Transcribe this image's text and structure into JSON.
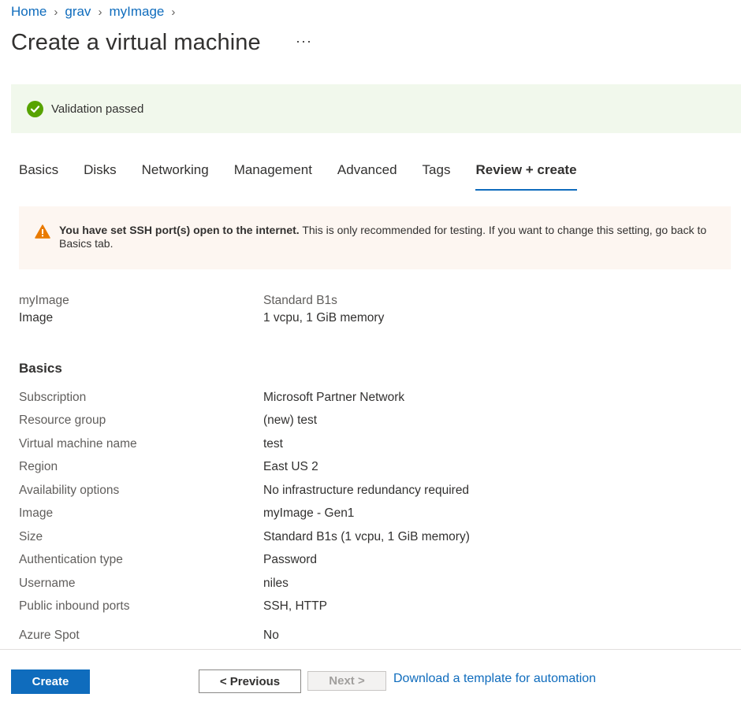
{
  "breadcrumb": [
    {
      "label": "Home"
    },
    {
      "label": "grav"
    },
    {
      "label": "myImage"
    }
  ],
  "page_title": "Create a virtual machine",
  "more_label": "···",
  "validation": {
    "text": "Validation passed",
    "color": "#57a300"
  },
  "tabs": [
    {
      "label": "Basics"
    },
    {
      "label": "Disks"
    },
    {
      "label": "Networking"
    },
    {
      "label": "Management"
    },
    {
      "label": "Advanced"
    },
    {
      "label": "Tags"
    },
    {
      "label": "Review + create",
      "active": true
    }
  ],
  "warning": {
    "bold": "You have set SSH port(s) open to the internet.",
    "text": "This is only recommended for testing.  If you want to change this setting, go back to Basics tab.",
    "icon": "warning-icon"
  },
  "summary": {
    "name": "myImage",
    "type": "Image",
    "size": "Standard B1s",
    "spec": "1 vcpu, 1 GiB memory"
  },
  "basics": {
    "heading": "Basics",
    "rows": [
      {
        "label": "Subscription",
        "value": "Microsoft Partner Network"
      },
      {
        "label": "Resource group",
        "value": "(new) test"
      },
      {
        "label": "Virtual machine name",
        "value": "test"
      },
      {
        "label": "Region",
        "value": "East US 2"
      },
      {
        "label": "Availability options",
        "value": "No infrastructure redundancy required"
      },
      {
        "label": "Image",
        "value": "myImage - Gen1"
      },
      {
        "label": "Size",
        "value": "Standard B1s (1 vcpu, 1 GiB memory)"
      },
      {
        "label": "Authentication type",
        "value": "Password"
      },
      {
        "label": "Username",
        "value": "niles"
      },
      {
        "label": "Public inbound ports",
        "value": "SSH, HTTP"
      },
      {
        "label": "Azure Spot",
        "value": "No"
      }
    ]
  },
  "footer": {
    "create_label": "Create",
    "previous_label": "< Previous",
    "next_label": "Next >",
    "download_label": "Download a template for automation"
  },
  "colors": {
    "accent": "#0f6cbd",
    "warning": "#e97a00",
    "success": "#57a300"
  }
}
